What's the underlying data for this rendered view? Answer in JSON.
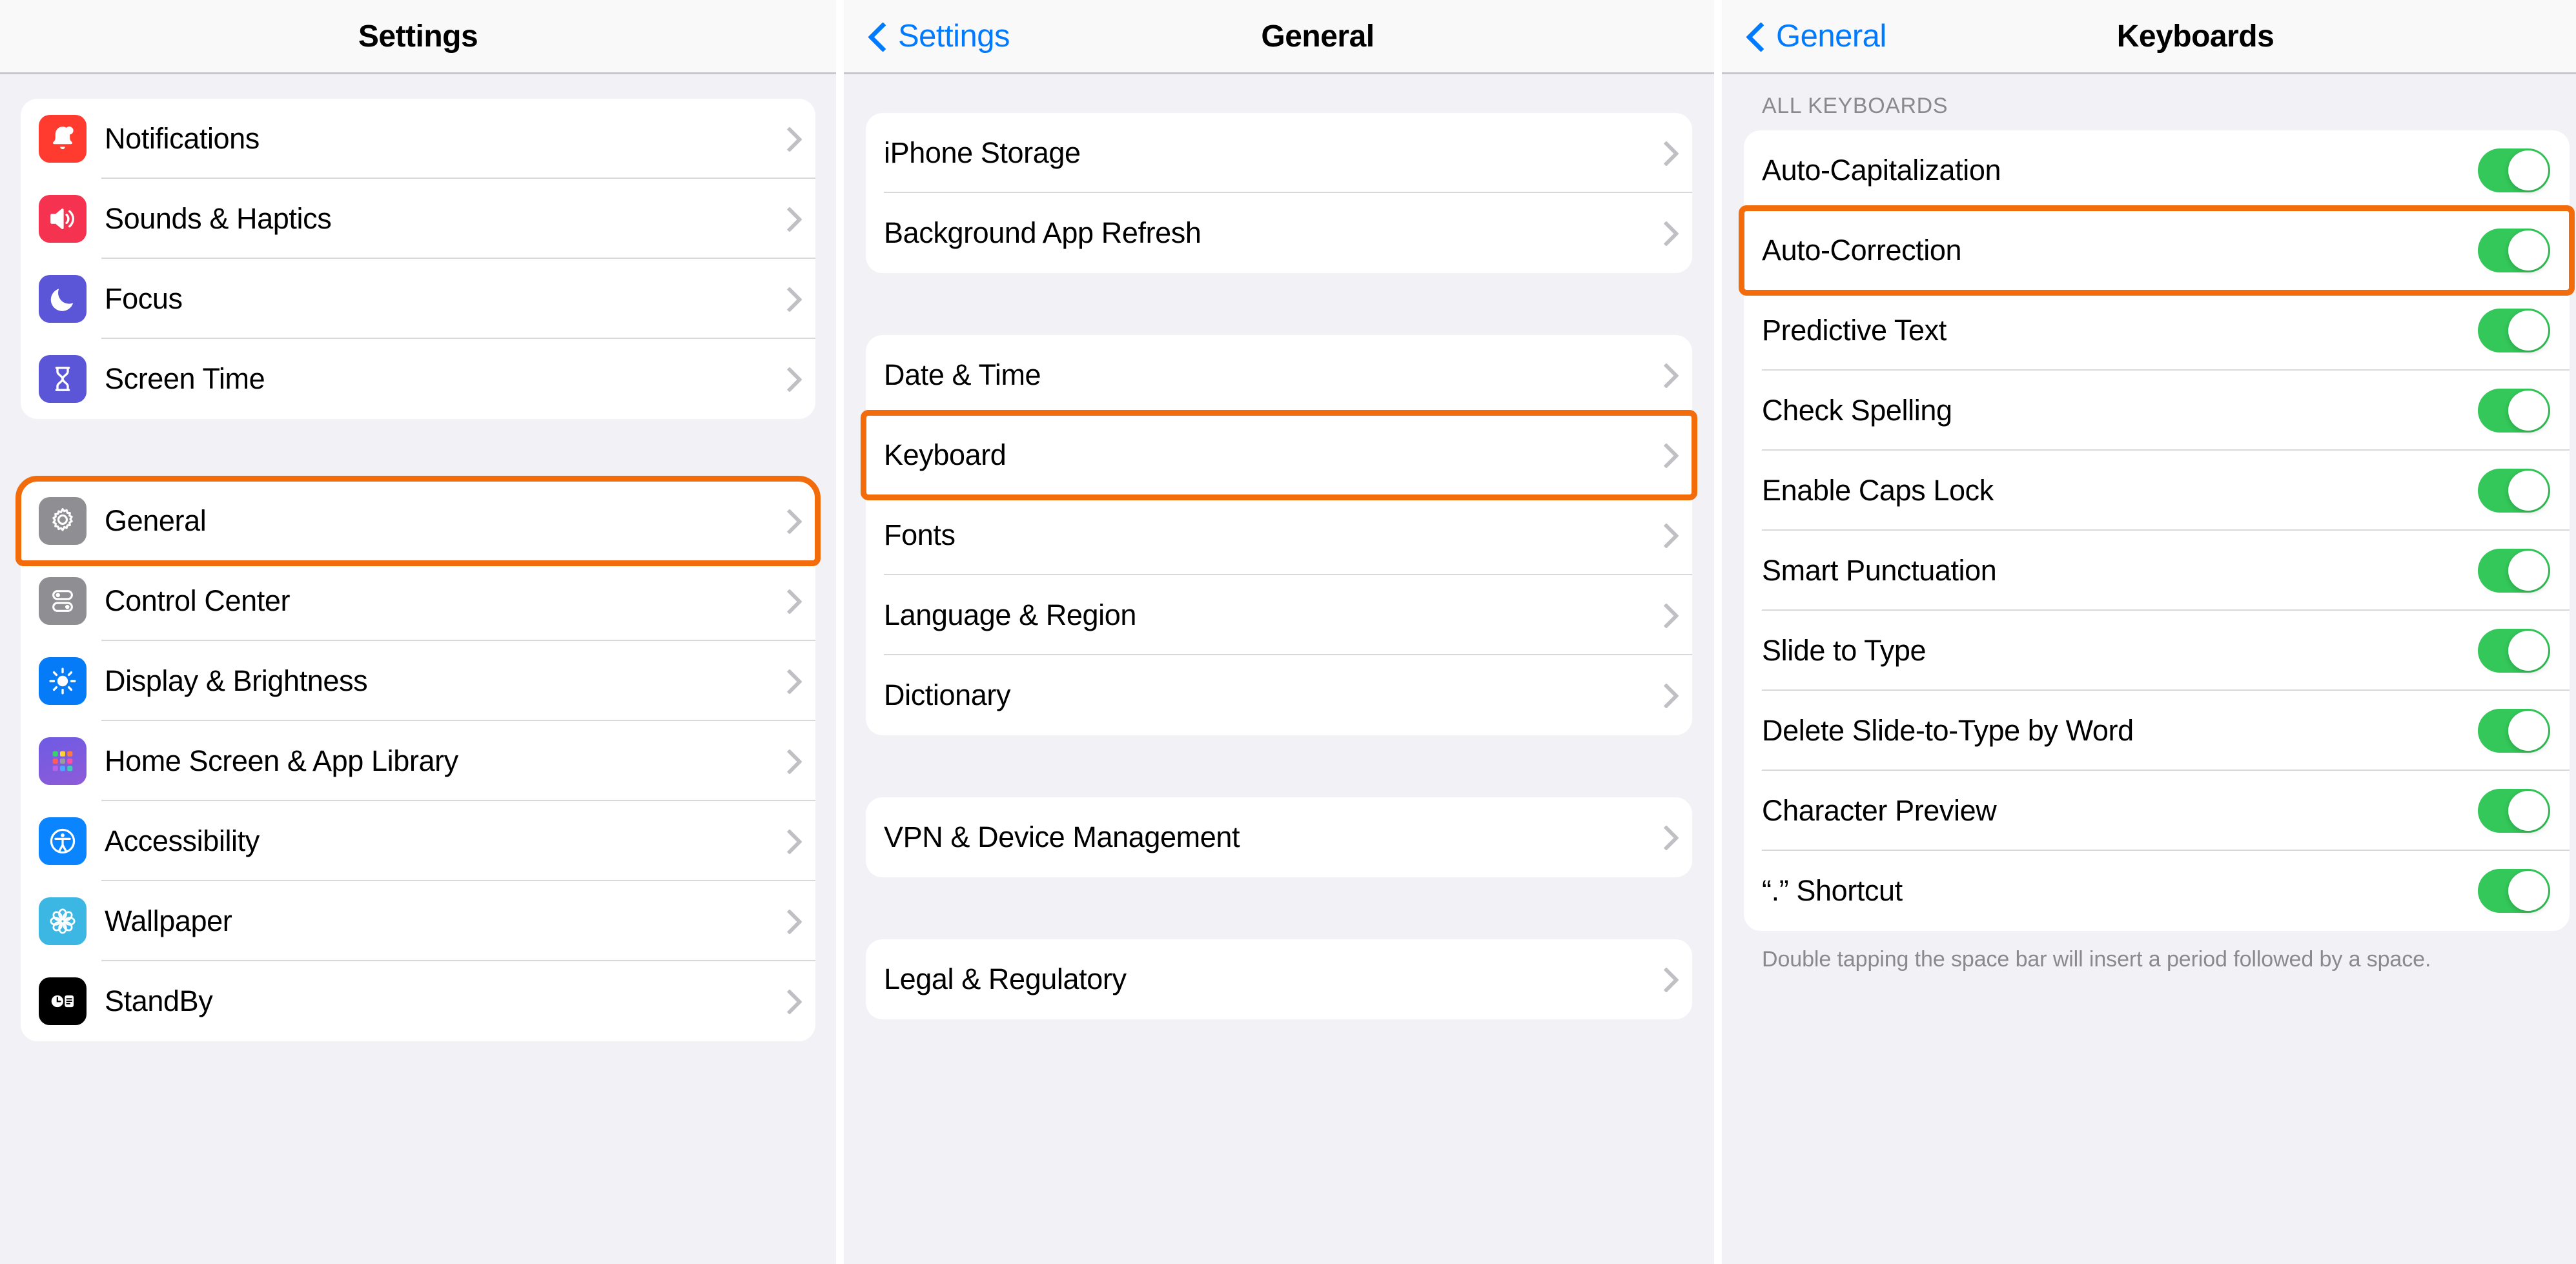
{
  "panels": {
    "settings": {
      "nav": {
        "title": "Settings",
        "back_label": null
      },
      "groups": [
        {
          "rows": [
            {
              "label": "Notifications",
              "icon": "notifications-bell-icon",
              "icon_color": "#FF3B30",
              "accessory": "chevron-right-icon"
            },
            {
              "label": "Sounds & Haptics",
              "icon": "speaker-waves-icon",
              "icon_color": "#F5324F",
              "accessory": "chevron-right-icon"
            },
            {
              "label": "Focus",
              "icon": "crescent-moon-icon",
              "icon_color": "#5B56D8",
              "accessory": "chevron-right-icon"
            },
            {
              "label": "Screen Time",
              "icon": "hourglass-icon",
              "icon_color": "#5B56D8",
              "accessory": "chevron-right-icon"
            }
          ]
        },
        {
          "rows": [
            {
              "label": "General",
              "icon": "gear-icon",
              "icon_color": "#8E8E93",
              "accessory": "chevron-right-icon",
              "highlighted": true
            },
            {
              "label": "Control Center",
              "icon": "control-center-icon",
              "icon_color": "#8E8E93",
              "accessory": "chevron-right-icon"
            },
            {
              "label": "Display & Brightness",
              "icon": "brightness-sun-icon",
              "icon_color": "#067BF7",
              "accessory": "chevron-right-icon"
            },
            {
              "label": "Home Screen & App Library",
              "icon": "app-grid-icon",
              "icon_color": "#6A5AE0",
              "accessory": "chevron-right-icon"
            },
            {
              "label": "Accessibility",
              "icon": "accessibility-icon",
              "icon_color": "#0A84FF",
              "accessory": "chevron-right-icon"
            },
            {
              "label": "Wallpaper",
              "icon": "flower-icon",
              "icon_color": "#3CB6E3",
              "accessory": "chevron-right-icon"
            },
            {
              "label": "StandBy",
              "icon": "standby-clock-icon",
              "icon_color": "#000000",
              "accessory": "chevron-right-icon"
            }
          ]
        }
      ]
    },
    "general": {
      "nav": {
        "title": "General",
        "back_label": "Settings"
      },
      "groups": [
        {
          "rows": [
            {
              "label": "iPhone Storage",
              "accessory": "chevron-right-icon"
            },
            {
              "label": "Background App Refresh",
              "accessory": "chevron-right-icon"
            }
          ]
        },
        {
          "rows": [
            {
              "label": "Date & Time",
              "accessory": "chevron-right-icon"
            },
            {
              "label": "Keyboard",
              "accessory": "chevron-right-icon",
              "highlighted": true
            },
            {
              "label": "Fonts",
              "accessory": "chevron-right-icon"
            },
            {
              "label": "Language & Region",
              "accessory": "chevron-right-icon"
            },
            {
              "label": "Dictionary",
              "accessory": "chevron-right-icon"
            }
          ]
        },
        {
          "rows": [
            {
              "label": "VPN & Device Management",
              "accessory": "chevron-right-icon"
            }
          ]
        },
        {
          "rows": [
            {
              "label": "Legal & Regulatory",
              "accessory": "chevron-right-icon"
            }
          ]
        }
      ]
    },
    "keyboards": {
      "nav": {
        "title": "Keyboards",
        "back_label": "General"
      },
      "section_header": "ALL KEYBOARDS",
      "section_footer": "Double tapping the space bar will insert a period followed by a space.",
      "rows": [
        {
          "label": "Auto-Capitalization",
          "toggle": "on"
        },
        {
          "label": "Auto-Correction",
          "toggle": "on",
          "highlighted": true
        },
        {
          "label": "Predictive Text",
          "toggle": "on"
        },
        {
          "label": "Check Spelling",
          "toggle": "on"
        },
        {
          "label": "Enable Caps Lock",
          "toggle": "on"
        },
        {
          "label": "Smart Punctuation",
          "toggle": "on"
        },
        {
          "label": "Slide to Type",
          "toggle": "on"
        },
        {
          "label": "Delete Slide-to-Type by Word",
          "toggle": "on"
        },
        {
          "label": "Character Preview",
          "toggle": "on"
        },
        {
          "label": "“.” Shortcut",
          "toggle": "on"
        }
      ]
    }
  },
  "colors": {
    "accent_blue": "#007AFF",
    "highlight_orange": "#F26C0C",
    "toggle_on_green": "#34C759",
    "page_background": "#F2F1F6",
    "card_background": "#FFFFFF",
    "separator": "#D8D7DB",
    "secondary_text": "#8A8A8E"
  }
}
